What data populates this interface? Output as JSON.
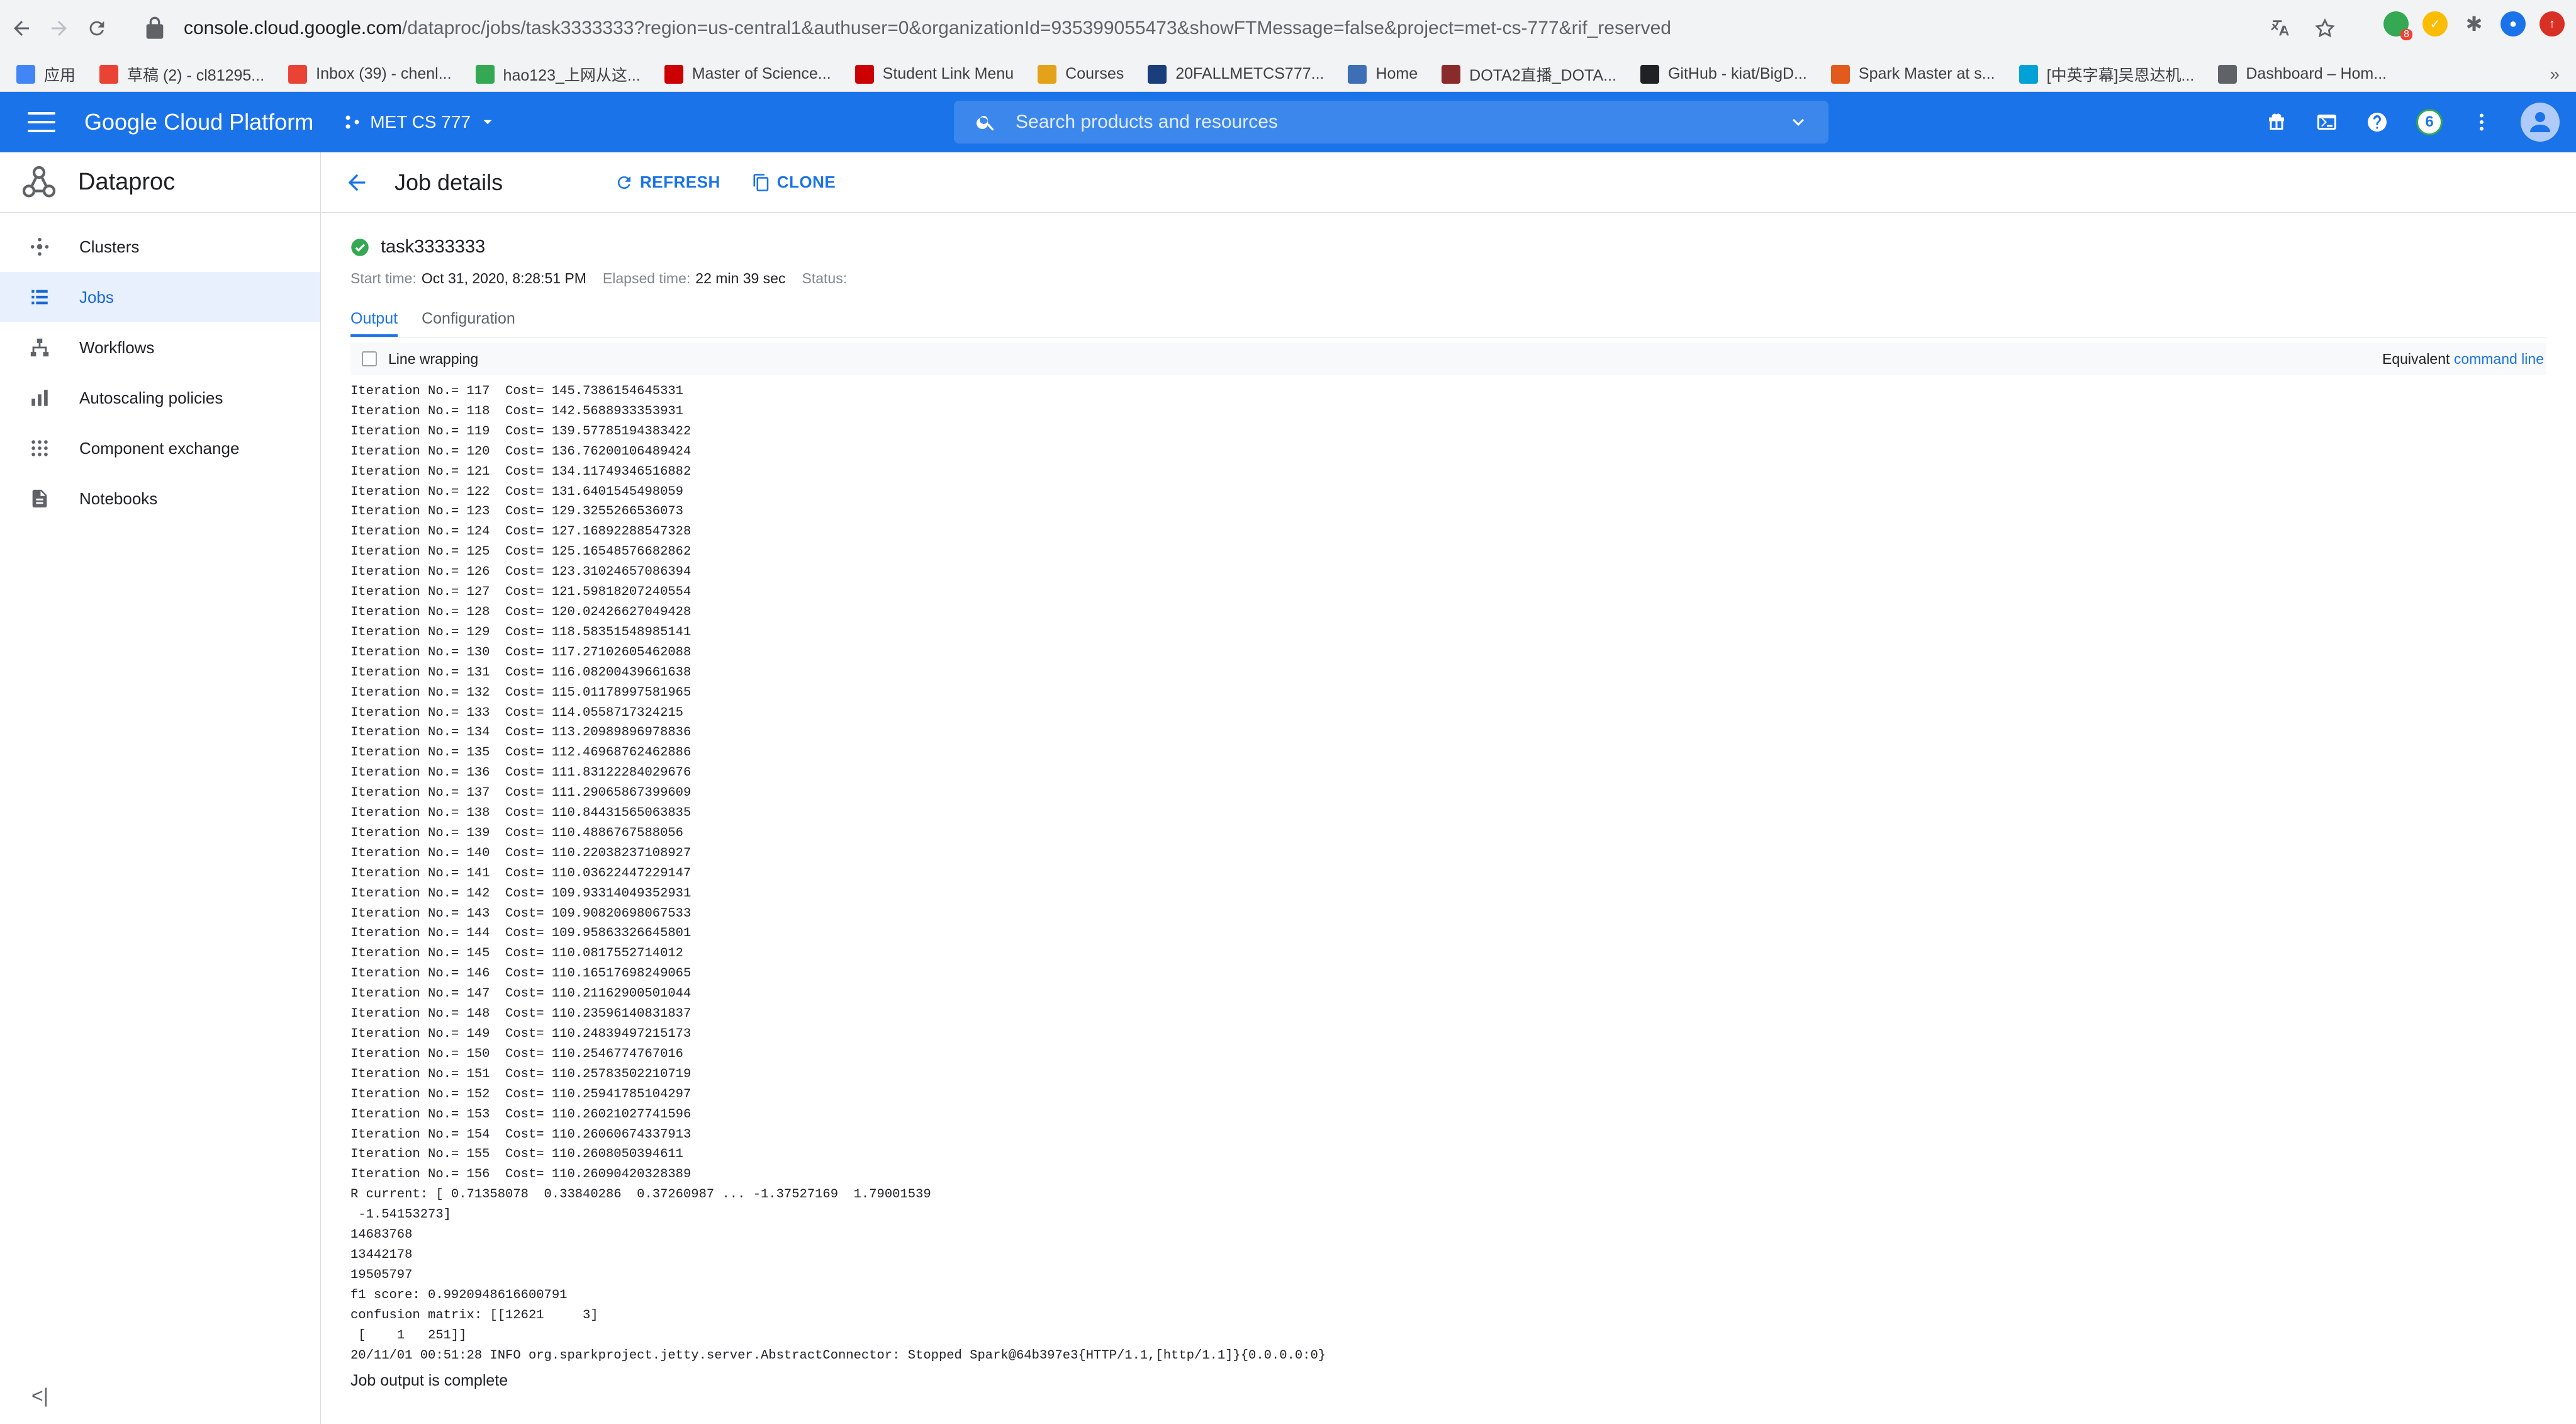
{
  "browser": {
    "url_host": "console.cloud.google.com",
    "url_rest": "/dataproc/jobs/task3333333?region=us-central1&authuser=0&organizationId=935399055473&showFTMessage=false&project=met-cs-777&rif_reserved",
    "extension_badge": "8",
    "bookmarks": [
      {
        "label": "应用",
        "color": "#4285f4"
      },
      {
        "label": "草稿 (2) - cl81295...",
        "color": "#ea4335"
      },
      {
        "label": "Inbox (39) - chenl...",
        "color": "#ea4335"
      },
      {
        "label": "hao123_上网从这...",
        "color": "#34a853"
      },
      {
        "label": "Master of Science...",
        "color": "#cc0000"
      },
      {
        "label": "Student Link Menu",
        "color": "#cc0000"
      },
      {
        "label": "Courses",
        "color": "#e3a21a"
      },
      {
        "label": "20FALLMETCS777...",
        "color": "#1a3d7c"
      },
      {
        "label": "Home",
        "color": "#3c6fb6"
      },
      {
        "label": "DOTA2直播_DOTA...",
        "color": "#8a2b2b"
      },
      {
        "label": "GitHub - kiat/BigD...",
        "color": "#202124"
      },
      {
        "label": "Spark Master at s...",
        "color": "#e25a1c"
      },
      {
        "label": "[中英字幕]吴恩达机...",
        "color": "#00a1d6"
      },
      {
        "label": "Dashboard – Hom...",
        "color": "#5f6368"
      }
    ],
    "bookmarks_more": "»"
  },
  "header": {
    "brand": "Google Cloud Platform",
    "project": "MET CS 777",
    "search_placeholder": "Search products and resources",
    "notification_count": "6"
  },
  "sidebar": {
    "product": "Dataproc",
    "items": [
      {
        "label": "Clusters",
        "icon": "clusters-icon"
      },
      {
        "label": "Jobs",
        "icon": "jobs-icon",
        "active": true
      },
      {
        "label": "Workflows",
        "icon": "workflows-icon"
      },
      {
        "label": "Autoscaling policies",
        "icon": "autoscaling-icon"
      },
      {
        "label": "Component exchange",
        "icon": "component-exchange-icon"
      },
      {
        "label": "Notebooks",
        "icon": "notebooks-icon"
      }
    ],
    "collapse": "<|"
  },
  "toolbar": {
    "title": "Job details",
    "refresh": "REFRESH",
    "clone": "CLONE"
  },
  "job": {
    "name": "task3333333",
    "start_label": "Start time:",
    "start_value": "Oct 31, 2020, 8:28:51 PM",
    "elapsed_label": "Elapsed time:",
    "elapsed_value": "22 min 39 sec",
    "status_label": "Status:"
  },
  "tabs": {
    "output": "Output",
    "configuration": "Configuration"
  },
  "output_options": {
    "line_wrapping": "Line wrapping",
    "equivalent": "Equivalent",
    "command_line": "command line"
  },
  "log_lines": [
    "Iteration No.= 117  Cost= 145.7386154645331",
    "Iteration No.= 118  Cost= 142.5688933353931",
    "Iteration No.= 119  Cost= 139.57785194383422",
    "Iteration No.= 120  Cost= 136.76200106489424",
    "Iteration No.= 121  Cost= 134.11749346516882",
    "Iteration No.= 122  Cost= 131.6401545498059",
    "Iteration No.= 123  Cost= 129.3255266536073",
    "Iteration No.= 124  Cost= 127.16892288547328",
    "Iteration No.= 125  Cost= 125.16548576682862",
    "Iteration No.= 126  Cost= 123.31024657086394",
    "Iteration No.= 127  Cost= 121.59818207240554",
    "Iteration No.= 128  Cost= 120.02426627049428",
    "Iteration No.= 129  Cost= 118.58351548985141",
    "Iteration No.= 130  Cost= 117.27102605462088",
    "Iteration No.= 131  Cost= 116.08200439661638",
    "Iteration No.= 132  Cost= 115.01178997581965",
    "Iteration No.= 133  Cost= 114.0558717324215",
    "Iteration No.= 134  Cost= 113.20989896978836",
    "Iteration No.= 135  Cost= 112.46968762462886",
    "Iteration No.= 136  Cost= 111.83122284029676",
    "Iteration No.= 137  Cost= 111.29065867399609",
    "Iteration No.= 138  Cost= 110.84431565063835",
    "Iteration No.= 139  Cost= 110.4886767588056",
    "Iteration No.= 140  Cost= 110.22038237108927",
    "Iteration No.= 141  Cost= 110.03622447229147",
    "Iteration No.= 142  Cost= 109.93314049352931",
    "Iteration No.= 143  Cost= 109.90820698067533",
    "Iteration No.= 144  Cost= 109.95863326645801",
    "Iteration No.= 145  Cost= 110.0817552714012",
    "Iteration No.= 146  Cost= 110.16517698249065",
    "Iteration No.= 147  Cost= 110.21162900501044",
    "Iteration No.= 148  Cost= 110.23596140831837",
    "Iteration No.= 149  Cost= 110.24839497215173",
    "Iteration No.= 150  Cost= 110.2546774767016",
    "Iteration No.= 151  Cost= 110.25783502210719",
    "Iteration No.= 152  Cost= 110.25941785104297",
    "Iteration No.= 153  Cost= 110.26021027741596",
    "Iteration No.= 154  Cost= 110.26060674337913",
    "Iteration No.= 155  Cost= 110.2608050394611",
    "Iteration No.= 156  Cost= 110.26090420328389",
    "R current: [ 0.71358078  0.33840286  0.37260987 ... -1.37527169  1.79001539",
    " -1.54153273]",
    "14683768",
    "13442178",
    "19505797",
    "f1 score: 0.9920948616600791",
    "confusion matrix: [[12621     3]",
    " [    1   251]]",
    "20/11/01 00:51:28 INFO org.sparkproject.jetty.server.AbstractConnector: Stopped Spark@64b397e3{HTTP/1.1,[http/1.1]}{0.0.0.0:0}"
  ],
  "job_complete": "Job output is complete",
  "colors": {
    "primary": "#1a73e8",
    "success": "#34a853",
    "sidebar_active_bg": "#e8f0fe"
  }
}
